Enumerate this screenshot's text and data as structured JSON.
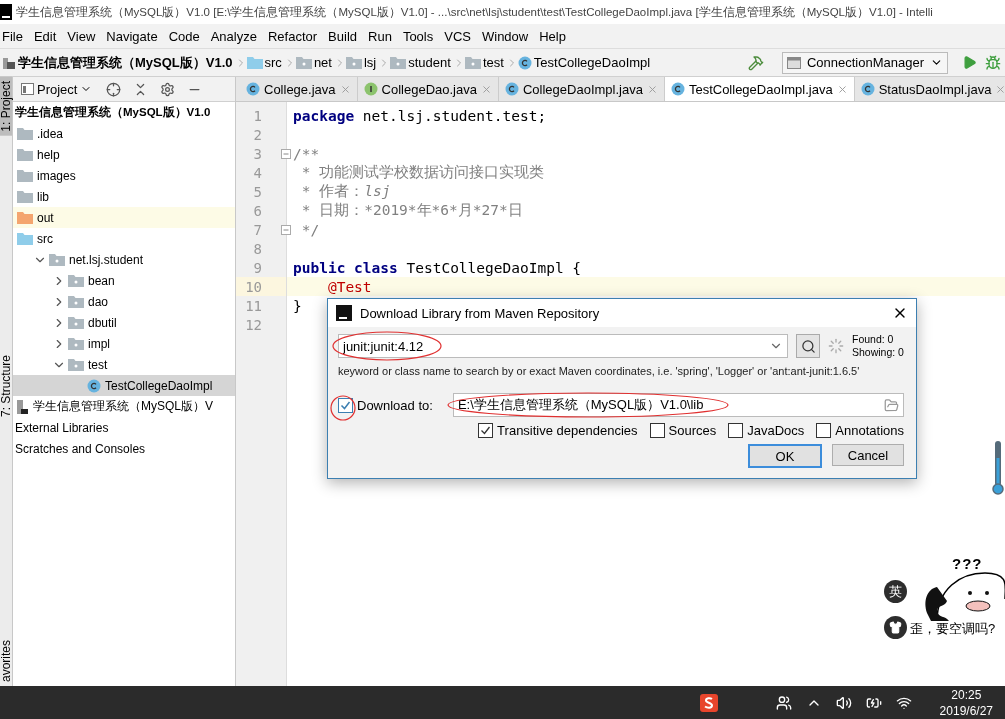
{
  "window": {
    "title": "学生信息管理系统（MySQL版）V1.0 [E:\\学生信息管理系统（MySQL版）V1.0] - ...\\src\\net\\lsj\\student\\test\\TestCollegeDaoImpl.java [学生信息管理系统（MySQL版）V1.0] - Intelli"
  },
  "menu": [
    "File",
    "Edit",
    "View",
    "Navigate",
    "Code",
    "Analyze",
    "Refactor",
    "Build",
    "Run",
    "Tools",
    "VCS",
    "Window",
    "Help"
  ],
  "breadcrumbs": [
    {
      "kind": "project",
      "label": "学生信息管理系统（MySQL版）V1.0"
    },
    {
      "kind": "folder",
      "label": "src"
    },
    {
      "kind": "package",
      "label": "net"
    },
    {
      "kind": "package",
      "label": "lsj"
    },
    {
      "kind": "package",
      "label": "student"
    },
    {
      "kind": "package",
      "label": "test"
    },
    {
      "kind": "class",
      "label": "TestCollegeDaoImpl"
    }
  ],
  "run_config": {
    "label": "ConnectionManager"
  },
  "side_stripe": [
    {
      "label": "1: Project",
      "selected": true
    },
    {
      "label": "7: Structure",
      "selected": false
    },
    {
      "label": "avorites",
      "selected": false
    }
  ],
  "project_panel": {
    "title": "Project"
  },
  "tree": [
    {
      "kind": "project",
      "label": "学生信息管理系统（MySQL版）V1.0",
      "selected": false,
      "children": [
        {
          "kind": "folder",
          "label": ".idea",
          "selected": false
        },
        {
          "kind": "folder",
          "label": "help",
          "selected": false
        },
        {
          "kind": "folder",
          "label": "images",
          "selected": false
        },
        {
          "kind": "folder",
          "label": "lib",
          "selected": false
        },
        {
          "kind": "excluded",
          "label": "out",
          "selected": false,
          "highlighted": true
        },
        {
          "kind": "source",
          "label": "src",
          "selected": false,
          "children": [
            {
              "kind": "package",
              "label": "net.lsj.student",
              "selected": false,
              "expanded": true,
              "children": [
                {
                  "kind": "package",
                  "label": "bean",
                  "selected": false,
                  "expanded": false
                },
                {
                  "kind": "package",
                  "label": "dao",
                  "selected": false,
                  "expanded": false
                },
                {
                  "kind": "package",
                  "label": "dbutil",
                  "selected": false,
                  "expanded": false
                },
                {
                  "kind": "package",
                  "label": "impl",
                  "selected": false,
                  "expanded": false
                },
                {
                  "kind": "package",
                  "label": "test",
                  "selected": false,
                  "expanded": true,
                  "children": [
                    {
                      "kind": "class",
                      "label": "TestCollegeDaoImpl",
                      "selected": true
                    }
                  ]
                }
              ]
            }
          ]
        }
      ]
    },
    {
      "kind": "module",
      "label": "学生信息管理系统（MySQL版）V",
      "selected": false
    },
    {
      "kind": "plain",
      "label": "External Libraries",
      "selected": false
    },
    {
      "kind": "plain",
      "label": "Scratches and Consoles",
      "selected": false
    }
  ],
  "tabs": [
    {
      "kind": "class",
      "label": "College.java",
      "selected": false
    },
    {
      "kind": "interface",
      "label": "CollegeDao.java",
      "selected": false
    },
    {
      "kind": "class",
      "label": "CollegeDaoImpl.java",
      "selected": false
    },
    {
      "kind": "class",
      "label": "TestCollegeDaoImpl.java",
      "selected": true
    },
    {
      "kind": "class",
      "label": "StatusDaoImpl.java",
      "selected": false
    }
  ],
  "editor": {
    "lines": [
      {
        "number": "1",
        "kind": "code",
        "text": "**package** net.lsj.student.test;",
        "current": false,
        "fold": false
      },
      {
        "number": "2",
        "kind": "blank",
        "current": false,
        "fold": false
      },
      {
        "number": "3",
        "kind": "comment",
        "text": "/**",
        "current": false,
        "fold": true
      },
      {
        "number": "4",
        "kind": "comment",
        "text": " * 功能测试学校数据访问接口实现类",
        "current": false,
        "fold": false
      },
      {
        "number": "5",
        "kind": "comment",
        "text": " * 作者：*lsj*",
        "current": false,
        "fold": false
      },
      {
        "number": "6",
        "kind": "comment",
        "text": " * 日期：*2019*年*6*月*27*日",
        "current": false,
        "fold": false
      },
      {
        "number": "7",
        "kind": "comment",
        "text": " */",
        "current": false,
        "fold": true
      },
      {
        "number": "8",
        "kind": "blank",
        "current": false,
        "fold": false
      },
      {
        "number": "9",
        "kind": "code",
        "text": "**public class** TestCollegeDaoImpl {",
        "current": false,
        "fold": false
      },
      {
        "number": "10",
        "kind": "annotation",
        "text": "    @Test",
        "current": true,
        "fold": false
      },
      {
        "number": "11",
        "kind": "code",
        "text": "}",
        "current": false,
        "fold": false
      },
      {
        "number": "12",
        "kind": "blank",
        "current": false,
        "fold": false
      }
    ]
  },
  "dialog": {
    "title": "Download Library from Maven Repository",
    "query": {
      "value": "junit:junit:4.12",
      "circled": true
    },
    "found": "Found: 0",
    "showing": "Showing: 0",
    "hint": "keyword or class name to search by or exact Maven coordinates, i.e. 'spring', 'Logger' or 'ant:ant-junit:1.6.5'",
    "download_to": {
      "label": "Download to:",
      "checked": true,
      "circled": true
    },
    "path": {
      "value": "E:\\学生信息管理系统（MySQL版）V1.0\\lib",
      "circled": true
    },
    "options": [
      {
        "label": "Transitive dependencies",
        "checked": true
      },
      {
        "label": "Sources",
        "checked": false
      },
      {
        "label": "JavaDocs",
        "checked": false
      },
      {
        "label": "Annotations",
        "checked": false
      }
    ],
    "buttons": [
      {
        "label": "OK",
        "default": true
      },
      {
        "label": "Cancel",
        "default": false
      }
    ]
  },
  "widget": {
    "thought": "???",
    "ime": "英",
    "caption": "歪，要空调吗?"
  },
  "taskbar": {
    "time": "20:25",
    "date": "2019/6/27"
  }
}
